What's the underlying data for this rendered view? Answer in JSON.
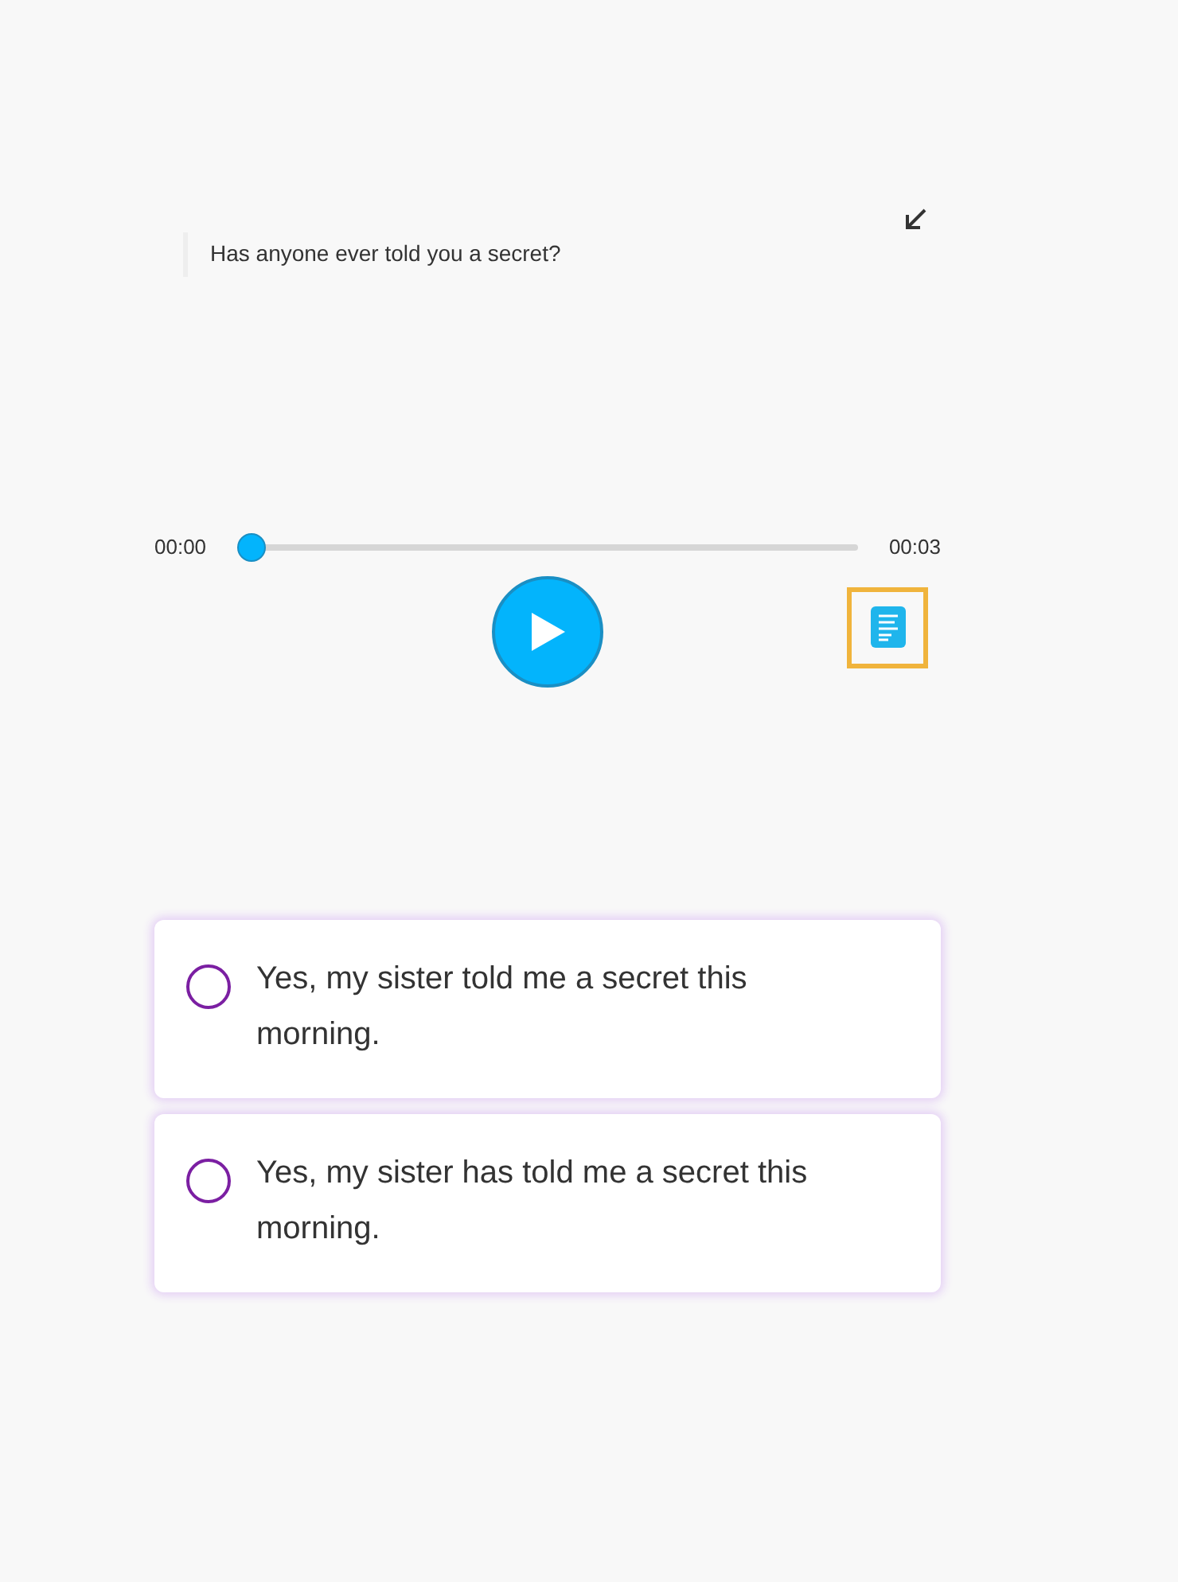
{
  "question": "Has anyone ever told you a secret?",
  "player": {
    "current_time": "00:00",
    "duration": "00:03",
    "level": 0,
    "playing": false
  },
  "options": [
    {
      "text": "Yes, my sister told me a secret this morning.",
      "selected": false
    },
    {
      "text": "Yes, my sister has told me a secret this morning.",
      "selected": false
    }
  ]
}
